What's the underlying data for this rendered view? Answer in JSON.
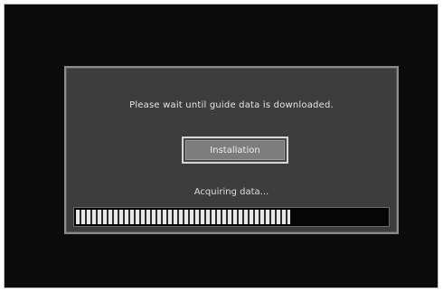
{
  "dialog": {
    "message": "Please wait until guide data is downloaded.",
    "button_label": "Installation",
    "status_text": "Acquiring data...",
    "progress_fraction": 0.69
  },
  "colors": {
    "screen_background": "#0b0b0b",
    "dialog_background": "#3d3d3d",
    "button_face": "#7c7c7c",
    "progress_fill": "#e8e8e8"
  }
}
